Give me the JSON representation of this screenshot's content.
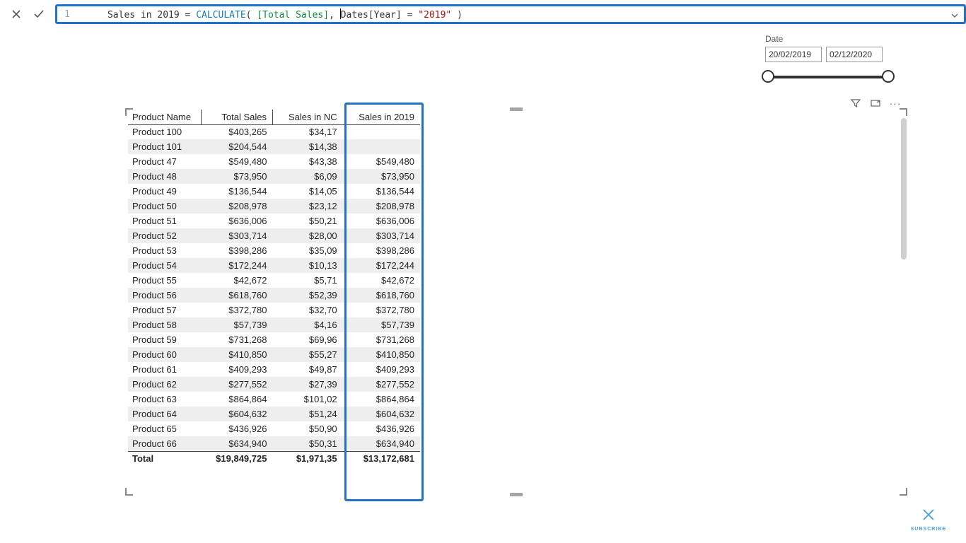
{
  "formula": {
    "line_no": "1",
    "prefix": "Sales in 2019 = ",
    "func": "CALCULATE",
    "open": "(",
    "arg1": " [Total Sales]",
    "comma": ", ",
    "arg2a": "Dates[Year]",
    "eq": " = ",
    "str": "\"2019\"",
    "close": " )"
  },
  "slicer": {
    "label": "Date",
    "from": "20/02/2019",
    "to": "02/12/2020"
  },
  "table": {
    "headers": [
      "Product Name",
      "Total Sales",
      "Sales in NC",
      "Sales in 2019"
    ],
    "rows": [
      [
        "Product 100",
        "$403,265",
        "$34,17",
        ""
      ],
      [
        "Product 101",
        "$204,544",
        "$14,38",
        ""
      ],
      [
        "Product 47",
        "$549,480",
        "$43,38",
        "$549,480"
      ],
      [
        "Product 48",
        "$73,950",
        "$6,09",
        "$73,950"
      ],
      [
        "Product 49",
        "$136,544",
        "$14,05",
        "$136,544"
      ],
      [
        "Product 50",
        "$208,978",
        "$23,12",
        "$208,978"
      ],
      [
        "Product 51",
        "$636,006",
        "$50,21",
        "$636,006"
      ],
      [
        "Product 52",
        "$303,714",
        "$28,00",
        "$303,714"
      ],
      [
        "Product 53",
        "$398,286",
        "$35,09",
        "$398,286"
      ],
      [
        "Product 54",
        "$172,244",
        "$10,13",
        "$172,244"
      ],
      [
        "Product 55",
        "$42,672",
        "$5,71",
        "$42,672"
      ],
      [
        "Product 56",
        "$618,760",
        "$52,39",
        "$618,760"
      ],
      [
        "Product 57",
        "$372,780",
        "$32,70",
        "$372,780"
      ],
      [
        "Product 58",
        "$57,739",
        "$4,16",
        "$57,739"
      ],
      [
        "Product 59",
        "$731,268",
        "$69,96",
        "$731,268"
      ],
      [
        "Product 60",
        "$410,850",
        "$55,27",
        "$410,850"
      ],
      [
        "Product 61",
        "$409,293",
        "$49,87",
        "$409,293"
      ],
      [
        "Product 62",
        "$277,552",
        "$27,39",
        "$277,552"
      ],
      [
        "Product 63",
        "$864,864",
        "$101,02",
        "$864,864"
      ],
      [
        "Product 64",
        "$604,632",
        "$51,24",
        "$604,632"
      ],
      [
        "Product 65",
        "$436,926",
        "$50,90",
        "$436,926"
      ],
      [
        "Product 66",
        "$634,940",
        "$50,31",
        "$634,940"
      ]
    ],
    "totals": [
      "Total",
      "$19,849,725",
      "$1,971,35",
      "$13,172,681"
    ]
  },
  "subscribe": {
    "label": "SUBSCRIBE"
  }
}
